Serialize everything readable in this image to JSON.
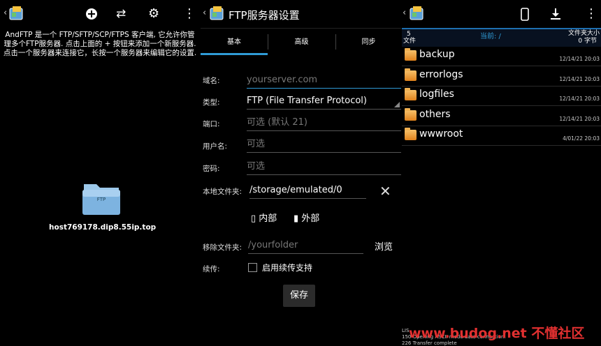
{
  "panel1": {
    "intro_text": "AndFTP 是一个 FTP/SFTP/SCP/FTPS 客户端, 它允许你管理多个FTP服务器. 点击上面的 + 按钮来添加一个新服务器. 点击一个服务器来连接它，长按一个服务器来编辑它的设置.",
    "toolbar": {
      "icons": [
        "add-icon",
        "swap-icon",
        "gear-icon",
        "overflow-menu-icon"
      ]
    },
    "server": {
      "hostname": "host769178.dip8.55ip.top",
      "folder_label": "FTP"
    }
  },
  "panel2": {
    "title": "FTP服务器设置",
    "tabs": [
      "基本",
      "高级",
      "同步"
    ],
    "selected_tab": "基本",
    "fields": {
      "host": {
        "label": "域名:",
        "placeholder": "yourserver.com"
      },
      "type": {
        "label": "类型:",
        "value": "FTP (File Transfer Protocol)"
      },
      "port": {
        "label": "端口:",
        "placeholder": "可选 (默认 21)"
      },
      "username": {
        "label": "用户名:",
        "placeholder": "可选"
      },
      "password": {
        "label": "密码:",
        "placeholder": "可选"
      },
      "local_folder": {
        "label": "本地文件夹:",
        "value": "/storage/emulated/0"
      },
      "remote_folder": {
        "label": "移除文件夹:",
        "placeholder": "/yourfolder"
      },
      "resume": {
        "label": "续传:",
        "checkbox_label": "启用续传支持",
        "checked": false
      }
    },
    "storage_internal": "内部",
    "storage_external": "外部",
    "browse_label": "浏览",
    "save_label": "保存"
  },
  "panel3": {
    "header": {
      "count": "5",
      "files_label": "文件",
      "current_label": "当前: /",
      "size_label": "文件夹大小",
      "size_value": "0 字节"
    },
    "files": [
      {
        "name": "backup",
        "date": "12/14/21 20:03"
      },
      {
        "name": "errorlogs",
        "date": "12/14/21 20:03"
      },
      {
        "name": "logfiles",
        "date": "12/14/21 20:03"
      },
      {
        "name": "others",
        "date": "12/14/21 20:03"
      },
      {
        "name": "wwwroot",
        "date": "4/01/22 20:03"
      }
    ],
    "log_lines": [
      "LIS",
      "150 Opening ASCII mode data connection.",
      "226 Transfer complete"
    ]
  },
  "watermark": "www.budog.net 不懂社区",
  "colors": {
    "accent": "#2f9bd6",
    "background": "#000000",
    "folder": "#f0a030",
    "watermark": "#e03030"
  }
}
